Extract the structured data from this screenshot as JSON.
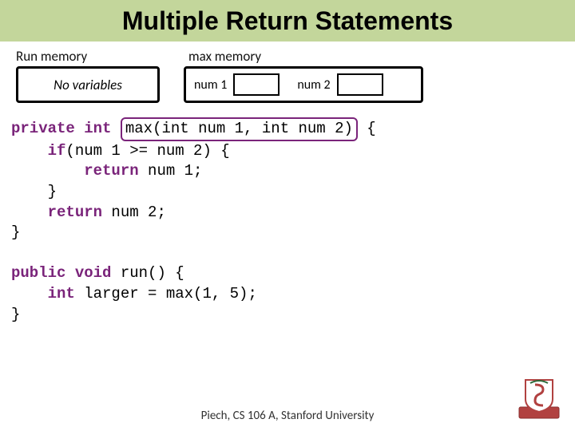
{
  "title": "Multiple Return Statements",
  "memory": {
    "run": {
      "label": "Run memory",
      "content": "No variables"
    },
    "max": {
      "label": "max memory",
      "vars": [
        {
          "name": "num 1"
        },
        {
          "name": "num 2"
        }
      ]
    }
  },
  "code": {
    "l1_private": "private",
    "l1_int": "int",
    "l1_sig": "max(int num 1, int num 2)",
    "l1_open": " {",
    "l2_indent": "    ",
    "l2_if": "if",
    "l2_cond": "(num 1 >= num 2) {",
    "l3_indent": "        ",
    "l3_return": "return",
    "l3_expr": " num 1;",
    "l4_indent": "    ",
    "l4_close": "}",
    "l5_indent": "    ",
    "l5_return": "return",
    "l5_expr": " num 2;",
    "l6_close": "}",
    "l8_public": "public",
    "l8_void": "void",
    "l8_rest": " run() {",
    "l9_indent": "    ",
    "l9_int": "int",
    "l9_rest": " larger = max(1, 5);",
    "l10_close": "}"
  },
  "footer": "Piech, CS 106 A, Stanford University"
}
